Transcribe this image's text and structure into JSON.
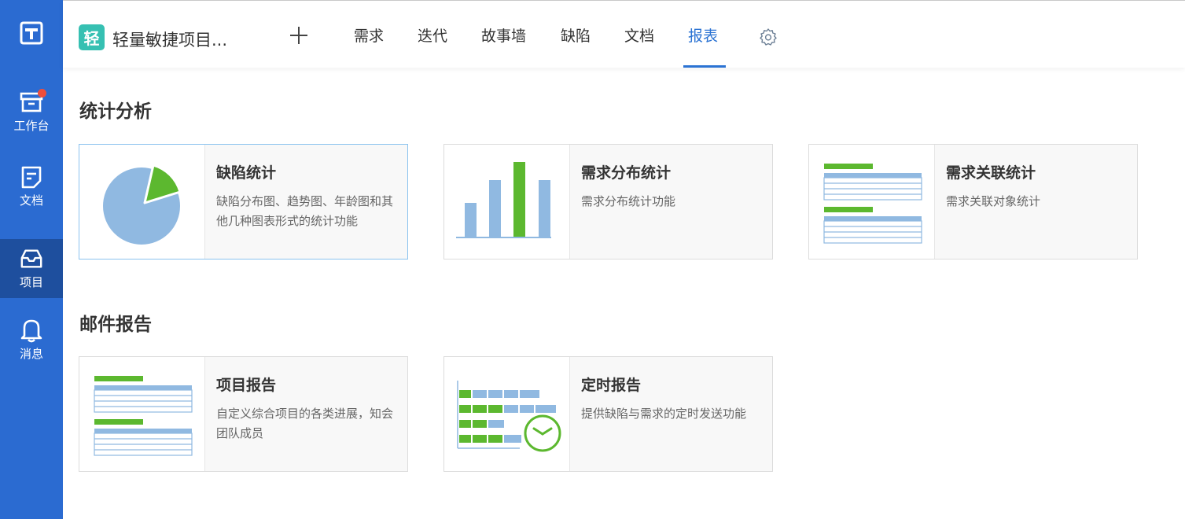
{
  "sidebar": {
    "items": [
      {
        "label": "工作台",
        "icon": "archive-icon",
        "badge": true
      },
      {
        "label": "文档",
        "icon": "document-icon"
      },
      {
        "label": "项目",
        "icon": "inbox-icon",
        "active": true
      },
      {
        "label": "消息",
        "icon": "bell-icon"
      }
    ]
  },
  "header": {
    "project_icon_char": "轻",
    "project_name": "轻量敏捷项目...",
    "tabs": [
      "需求",
      "迭代",
      "故事墙",
      "缺陷",
      "文档",
      "报表"
    ],
    "active_tab": "报表"
  },
  "sections": [
    {
      "title": "统计分析",
      "cards": [
        {
          "title": "缺陷统计",
          "desc": "缺陷分布图、趋势图、年龄图和其他几种图表形式的统计功能"
        },
        {
          "title": "需求分布统计",
          "desc": "需求分布统计功能"
        },
        {
          "title": "需求关联统计",
          "desc": "需求关联对象统计"
        }
      ]
    },
    {
      "title": "邮件报告",
      "cards": [
        {
          "title": "项目报告",
          "desc": "自定义综合项目的各类进展，知会团队成员"
        },
        {
          "title": "定时报告",
          "desc": "提供缺陷与需求的定时发送功能"
        }
      ]
    }
  ],
  "colors": {
    "sidebar": "#2b6bd1",
    "sidebar_active": "#1e4f9e",
    "accent": "#2b73d3",
    "green": "#5cb82f",
    "blue_light": "#90b9e1",
    "badge": "#ef4e3c",
    "project_icon": "#36c0b2"
  }
}
